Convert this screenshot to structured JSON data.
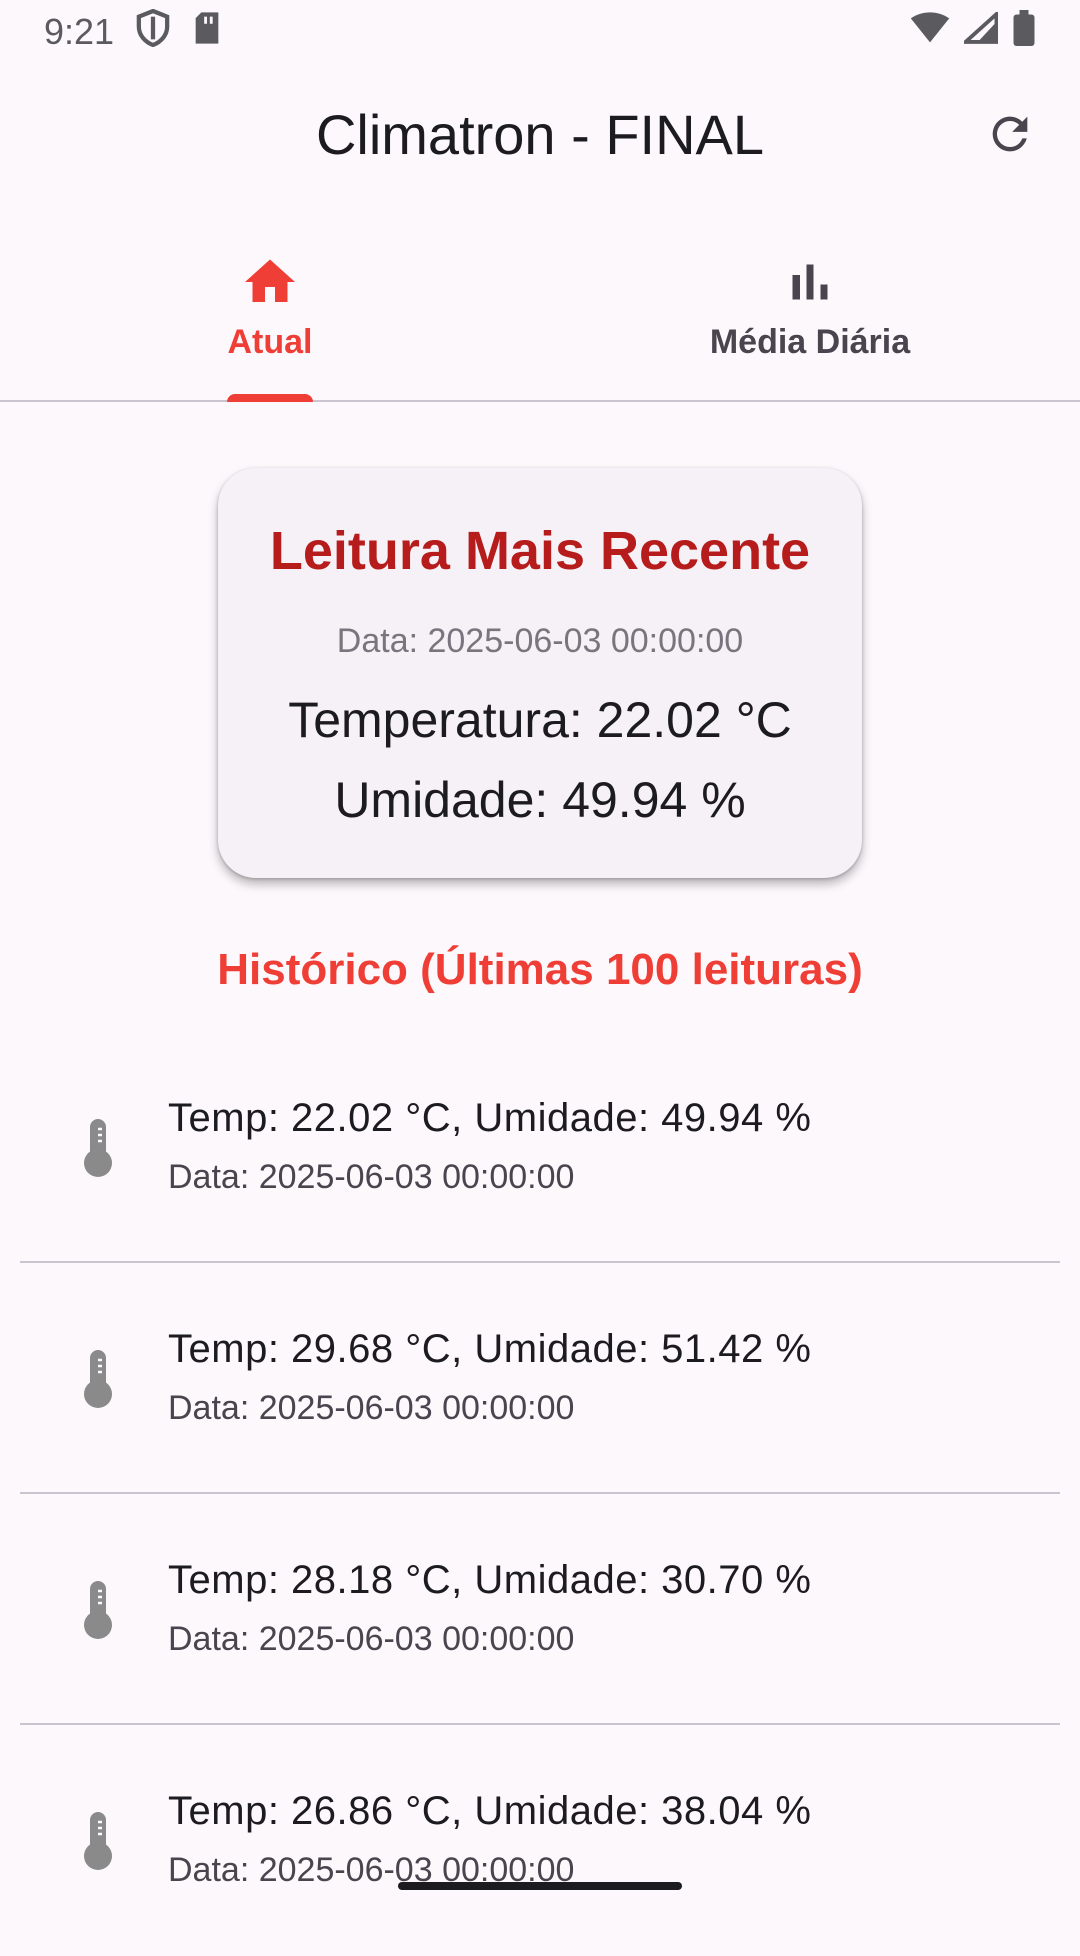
{
  "status_bar": {
    "time": "9:21"
  },
  "app_bar": {
    "title": "Climatron - FINAL"
  },
  "tabs": [
    {
      "label": "Atual",
      "icon": "home-icon",
      "selected": true
    },
    {
      "label": "Média Diária",
      "icon": "bar-chart-icon",
      "selected": false
    }
  ],
  "latest": {
    "title": "Leitura Mais Recente",
    "date": "Data: 2025-06-03 00:00:00",
    "temperature": "Temperatura: 22.02 °C",
    "humidity": "Umidade: 49.94 %"
  },
  "history": {
    "title": "Histórico (Últimas 100 leituras)",
    "items": [
      {
        "primary": "Temp: 22.02 °C, Umidade: 49.94 %",
        "secondary": "Data: 2025-06-03 00:00:00"
      },
      {
        "primary": "Temp: 29.68 °C, Umidade: 51.42 %",
        "secondary": "Data: 2025-06-03 00:00:00"
      },
      {
        "primary": "Temp: 28.18 °C, Umidade: 30.70 %",
        "secondary": "Data: 2025-06-03 00:00:00"
      },
      {
        "primary": "Temp: 26.86 °C, Umidade: 38.04 %",
        "secondary": "Data: 2025-06-03 00:00:00"
      }
    ]
  },
  "colors": {
    "accent": "#ef3e36",
    "card_title": "#b71c1c",
    "background": "#fdf8fc",
    "icon_grey": "#8a8a8a"
  }
}
